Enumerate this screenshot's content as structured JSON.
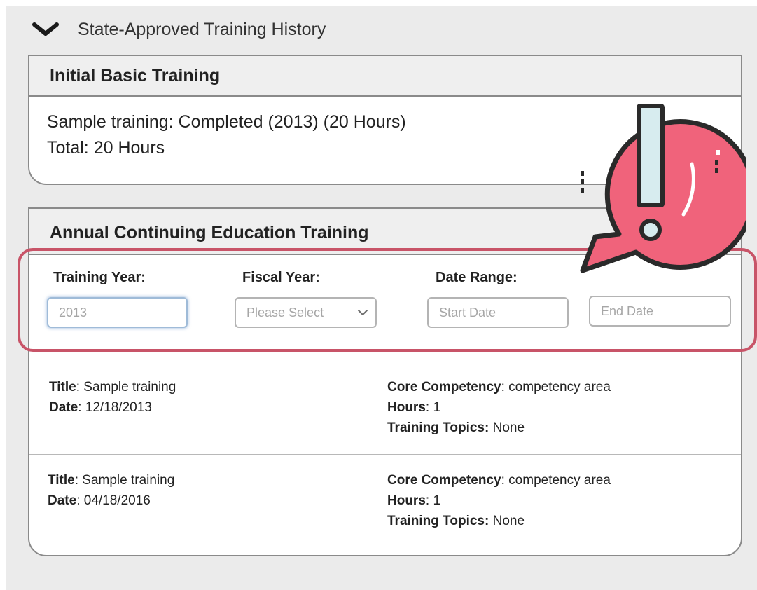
{
  "section": {
    "title": "State-Approved Training History"
  },
  "basic": {
    "header": "Initial Basic Training",
    "line1": "Sample training: Completed (2013) (20 Hours)",
    "line2": "Total: 20 Hours"
  },
  "annual": {
    "header": "Annual Continuing Education Training",
    "filters": {
      "training_year_label": "Training Year:",
      "training_year_value": "2013",
      "fiscal_year_label": "Fiscal Year:",
      "fiscal_year_selected": "Please Select",
      "date_range_label": "Date Range:",
      "start_date_placeholder": "Start Date",
      "end_date_placeholder": "End Date"
    },
    "field_labels": {
      "title": "Title",
      "date": "Date",
      "core_competency": "Core Competency",
      "hours": "Hours",
      "training_topics": "Training Topics:"
    },
    "records": [
      {
        "title": "Sample training",
        "date": "12/18/2013",
        "core_competency": "competency area",
        "hours": "1",
        "training_topics": "None"
      },
      {
        "title": "Sample training",
        "date": "04/18/2016",
        "core_competency": "competency area",
        "hours": "1",
        "training_topics": "None"
      }
    ]
  },
  "icons": {
    "toggle": "chevron-down-icon",
    "select_caret": "chevron-down-icon",
    "alert": "exclamation-speech-bubble-icon"
  },
  "colors": {
    "alert_fill": "#f0637b",
    "alert_outline": "#2a2a2a",
    "highlight_border": "#c85468",
    "focus_border": "#9fbbd8"
  }
}
